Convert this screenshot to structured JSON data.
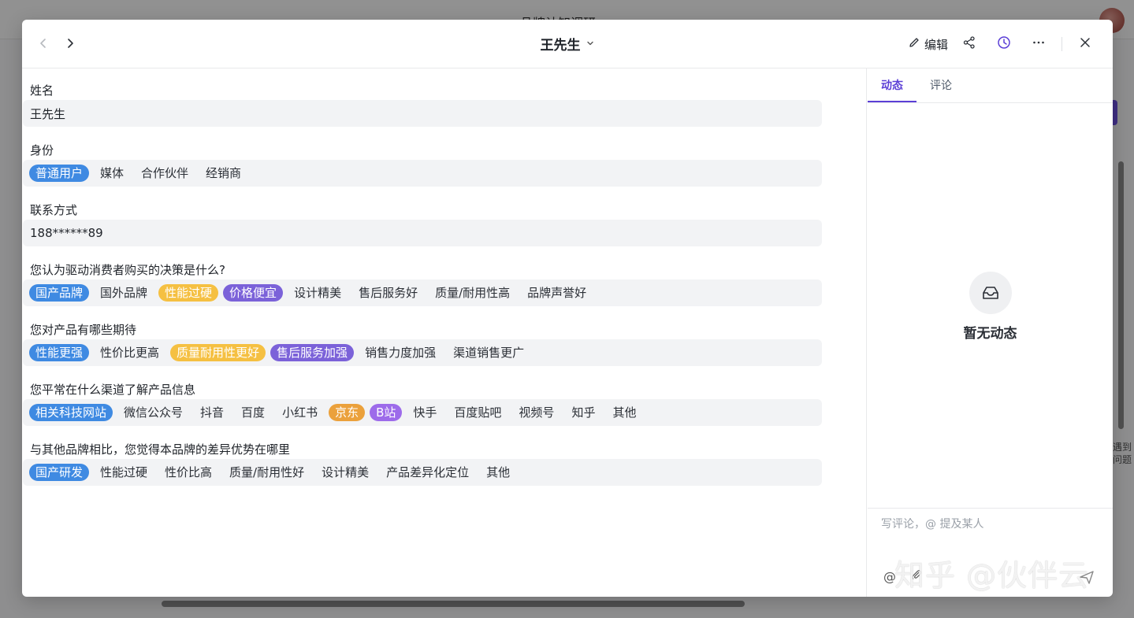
{
  "background": {
    "app_title": "品牌认知调研",
    "help_text": "遇到问题"
  },
  "header": {
    "record_title": "王先生",
    "edit_label": "编辑"
  },
  "fields": [
    {
      "label": "姓名",
      "type": "text",
      "value": "王先生"
    },
    {
      "label": "身份",
      "type": "options",
      "options": [
        {
          "text": "普通用户",
          "selected": true,
          "color": "#3f8ae2"
        },
        {
          "text": "媒体",
          "selected": false
        },
        {
          "text": "合作伙伴",
          "selected": false
        },
        {
          "text": "经销商",
          "selected": false
        }
      ]
    },
    {
      "label": "联系方式",
      "type": "text",
      "value": "188******89"
    },
    {
      "label": "您认为驱动消费者购买的决策是什么?",
      "type": "options",
      "options": [
        {
          "text": "国产品牌",
          "selected": true,
          "color": "#3f8ae2"
        },
        {
          "text": "国外品牌",
          "selected": false
        },
        {
          "text": "性能过硬",
          "selected": true,
          "color": "#f5c042"
        },
        {
          "text": "价格便宜",
          "selected": true,
          "color": "#7b62d9"
        },
        {
          "text": "设计精美",
          "selected": false
        },
        {
          "text": "售后服务好",
          "selected": false
        },
        {
          "text": "质量/耐用性高",
          "selected": false
        },
        {
          "text": "品牌声誉好",
          "selected": false
        }
      ]
    },
    {
      "label": "您对产品有哪些期待",
      "type": "options",
      "options": [
        {
          "text": "性能更强",
          "selected": true,
          "color": "#3f8ae2"
        },
        {
          "text": "性价比更高",
          "selected": false
        },
        {
          "text": "质量耐用性更好",
          "selected": true,
          "color": "#f5c042"
        },
        {
          "text": "售后服务加强",
          "selected": true,
          "color": "#7b62d9"
        },
        {
          "text": "销售力度加强",
          "selected": false
        },
        {
          "text": "渠道销售更广",
          "selected": false
        }
      ]
    },
    {
      "label": "您平常在什么渠道了解产品信息",
      "type": "options",
      "options": [
        {
          "text": "相关科技网站",
          "selected": true,
          "color": "#3f8ae2"
        },
        {
          "text": "微信公众号",
          "selected": false
        },
        {
          "text": "抖音",
          "selected": false
        },
        {
          "text": "百度",
          "selected": false
        },
        {
          "text": "小红书",
          "selected": false
        },
        {
          "text": "京东",
          "selected": true,
          "color": "#eba13c"
        },
        {
          "text": "B站",
          "selected": true,
          "color": "#9d6bea"
        },
        {
          "text": "快手",
          "selected": false
        },
        {
          "text": "百度贴吧",
          "selected": false
        },
        {
          "text": "视频号",
          "selected": false
        },
        {
          "text": "知乎",
          "selected": false
        },
        {
          "text": "其他",
          "selected": false
        }
      ]
    },
    {
      "label": "与其他品牌相比，您觉得本品牌的差异优势在哪里",
      "type": "options",
      "options": [
        {
          "text": "国产研发",
          "selected": true,
          "color": "#3f8ae2"
        },
        {
          "text": "性能过硬",
          "selected": false
        },
        {
          "text": "性价比高",
          "selected": false
        },
        {
          "text": "质量/耐用性好",
          "selected": false
        },
        {
          "text": "设计精美",
          "selected": false
        },
        {
          "text": "产品差异化定位",
          "selected": false
        },
        {
          "text": "其他",
          "selected": false
        }
      ]
    }
  ],
  "side": {
    "tabs": [
      {
        "label": "动态",
        "active": true
      },
      {
        "label": "评论",
        "active": false
      }
    ],
    "empty_text": "暂无动态",
    "comment_placeholder": "写评论，@ 提及某人"
  },
  "watermark": "知乎 @伙伴云",
  "icons": [
    "chevron-left-icon",
    "chevron-right-icon",
    "chevron-down-icon",
    "pencil-icon",
    "share-icon",
    "clock-icon",
    "more-icon",
    "close-icon",
    "inbox-icon",
    "at-icon",
    "attachment-icon",
    "send-icon"
  ],
  "colors": {
    "accent": "#5b3fd6",
    "field_bg": "#f2f3f5"
  }
}
